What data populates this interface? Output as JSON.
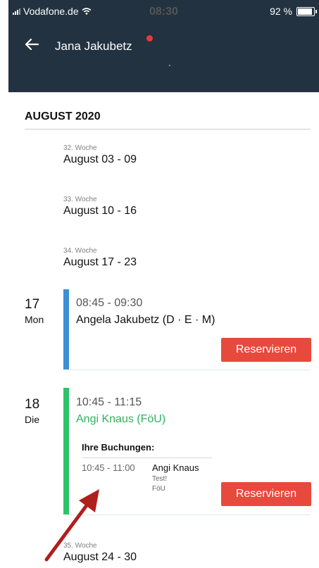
{
  "status_bar": {
    "carrier": "Vodafone.de",
    "time": "08:30",
    "battery": "92 %"
  },
  "header": {
    "title": "Jana Jakubetz"
  },
  "month": {
    "label": "AUGUST 2020"
  },
  "weeks": [
    {
      "label": "32. Woche",
      "range": "August 03 - 09"
    },
    {
      "label": "33. Woche",
      "range": "August 10 - 16"
    },
    {
      "label": "34. Woche",
      "range": "August 17 - 23"
    },
    {
      "label": "35. Woche",
      "range": "August 24 - 30"
    }
  ],
  "days": [
    {
      "num": "17",
      "name": "Mon",
      "time": "08:45 - 09:30",
      "course": "Angela Jakubetz (D · E · M)",
      "reserve_label": "Reservieren",
      "color": "#3a8fd6"
    },
    {
      "num": "18",
      "name": "Die",
      "time": "10:45 - 11:15",
      "course": "Angi Knaus (FöU)",
      "reserve_label": "Reservieren",
      "color": "#2ec46a",
      "bookings_title": "Ihre Buchungen:",
      "booking": {
        "time": "10:45 - 11:00",
        "name": "Angi Knaus",
        "note1": "Test!",
        "note2": "FöU"
      }
    }
  ],
  "colors": {
    "header_bg": "#223240",
    "reserve_bg": "#e8493d",
    "annotation_arrow": "#b01e1e"
  }
}
